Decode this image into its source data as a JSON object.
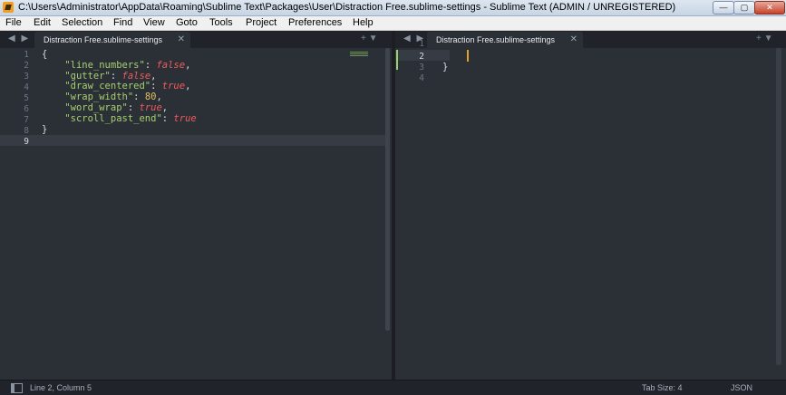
{
  "window": {
    "title": "C:\\Users\\Administrator\\AppData\\Roaming\\Sublime Text\\Packages\\User\\Distraction Free.sublime-settings - Sublime Text (ADMIN / UNREGISTERED)",
    "min_glyph": "—",
    "max_glyph": "▢",
    "close_glyph": "✕"
  },
  "menu": {
    "items": [
      "File",
      "Edit",
      "Selection",
      "Find",
      "View",
      "Goto",
      "Tools",
      "Project",
      "Preferences",
      "Help"
    ]
  },
  "left_pane": {
    "tab_label": "Distraction Free.sublime-settings",
    "nav_glyph": "◀ ▶",
    "close_glyph": "✕",
    "tools_glyph": "+ ▼",
    "line_numbers": [
      "1",
      "2",
      "3",
      "4",
      "5",
      "6",
      "7",
      "8",
      "9"
    ],
    "active_line": "9",
    "code": {
      "l1": "{",
      "k2": "\"line_numbers\"",
      "v2": "false",
      "k3": "\"gutter\"",
      "v3": "false",
      "k4": "\"draw_centered\"",
      "v4": "true",
      "k5": "\"wrap_width\"",
      "v5": "80",
      "k6": "\"word_wrap\"",
      "v6": "true",
      "k7": "\"scroll_past_end\"",
      "v7": "true",
      "l8": "}"
    }
  },
  "right_pane": {
    "tab_label": "Distraction Free.sublime-settings",
    "nav_glyph": "◀ ▶",
    "close_glyph": "✕",
    "tools_glyph": "+ ▼",
    "line_numbers": [
      "1",
      "2",
      "3",
      "4"
    ],
    "active_line": "2",
    "code": {
      "l3": "}"
    }
  },
  "status": {
    "position": "Line 2, Column 5",
    "tab_size": "Tab Size: 4",
    "syntax": "JSON"
  },
  "colors": {
    "bg": "#2b2f36",
    "key": "#a6d070",
    "boolean": "#ef5b5b",
    "number": "#e0c060",
    "cursor": "#e0a030"
  }
}
